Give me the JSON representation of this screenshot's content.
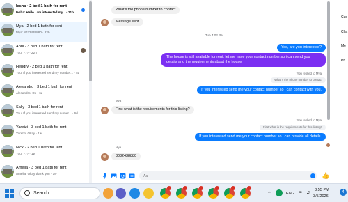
{
  "conversations": [
    {
      "title": "Iesha · 2 bed 1 bath for rent",
      "preview": "Iesha: Hello I am interested my... · 21h",
      "unread": true,
      "active": false
    },
    {
      "title": "Mya · 2 bed 1 bath for rent",
      "preview": "Mya: 8032438880 · 22h",
      "unread": false,
      "active": true
    },
    {
      "title": "April · 3 bed 1 bath for rent",
      "preview": "You: ??? · 22h",
      "unread": false,
      "active": false
    },
    {
      "title": "Hendry · 2 bed 1 bath for rent",
      "preview": "You: If you interested send my number... · 5d",
      "unread": false,
      "active": false
    },
    {
      "title": "Alesandro · 3 bed 1 bath for rent",
      "preview": "Alesandro: Ok · 6d",
      "unread": false,
      "active": false
    },
    {
      "title": "Sally · 3 bed 1 bath for rent",
      "preview": "You: If you interested send my numer... · 6d",
      "unread": false,
      "active": false
    },
    {
      "title": "Yaretzi · 3 bed 1 bath for rent",
      "preview": "Yaretzi: Okay · 1w",
      "unread": false,
      "active": false
    },
    {
      "title": "Nick · 2 bed 1 bath for rent",
      "preview": "You: ??? · 1w",
      "unread": false,
      "active": false
    },
    {
      "title": "Amelia · 3 bed 1 bath for rent",
      "preview": "Amelia: Okay thank you · 1w",
      "unread": false,
      "active": false
    }
  ],
  "chat": {
    "msg_phone_question": "What's the phone number to contact",
    "msg_sent": "Message sent",
    "timestamp": "Tue 4:02 PM",
    "out_interested": "Yes, are you interested?",
    "out_long": "The house is still available for rent. let me have your contact number so i can send you details and the requirements about the house",
    "reply_label_1": "You replied to Mya",
    "reply_quote_1": "What's the phone number to contact",
    "out_contact": "If you interested send me your contact number so i can contact with you.",
    "sender_1": "Mya",
    "msg_requirements": "First what is the requirements for this listing?",
    "reply_label_2": "You replied to Mya",
    "reply_quote_2": "First what is the requirements for this listing?",
    "out_details": "If you interested send me your contact number so i can provide all details.",
    "sender_2": "Mya",
    "msg_number": "8032438880"
  },
  "composer": {
    "placeholder": "Aa",
    "like_icon": "thumbs-up-icon"
  },
  "info_panel": [
    "Cus",
    "Cha",
    "Me",
    "Pri"
  ],
  "taskbar": {
    "search_label": "Search",
    "language": "ENG",
    "time": "8:55 PM",
    "date": "3/5/2026",
    "notification_count": "4"
  },
  "colors": {
    "outgoing": "#0a7cff",
    "outgoing_long": "#7b2ff2",
    "incoming": "#f0f0f0"
  }
}
